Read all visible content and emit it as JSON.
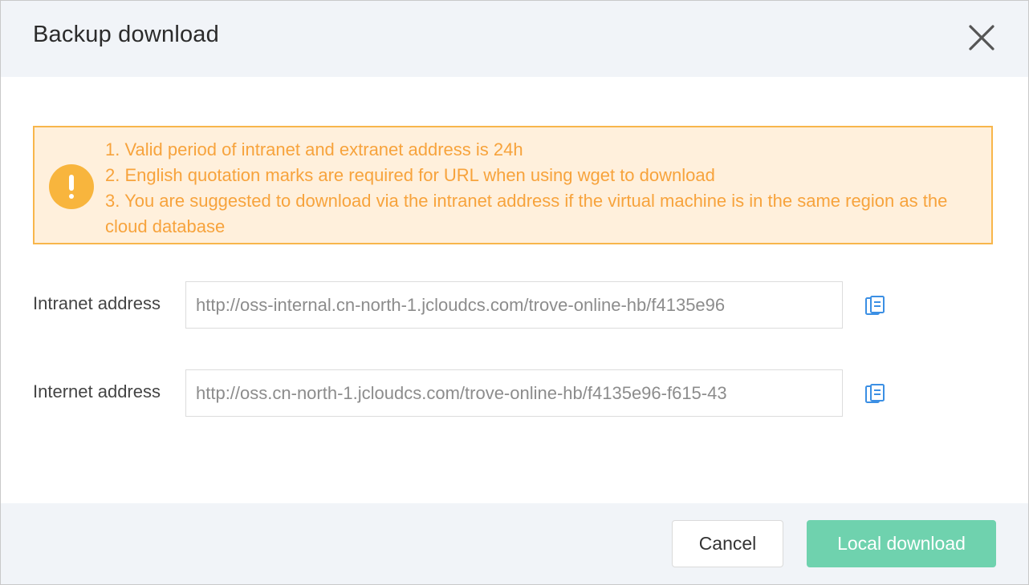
{
  "dialog": {
    "title": "Backup download",
    "close_icon": "close-icon"
  },
  "notice": {
    "icon": "warning-icon",
    "color": "#f7a33c",
    "background": "#fff0dc",
    "lines": [
      "1. Valid period of intranet and extranet address is 24h",
      "2. English quotation marks are required for URL when using wget to download",
      "3. You are suggested to download via the intranet address if the virtual machine is in the same region as the cloud database"
    ]
  },
  "fields": {
    "intranet": {
      "label": "Intranet address",
      "value": "http://oss-internal.cn-north-1.jcloudcs.com/trove-online-hb/f4135e96",
      "copy_icon": "copy-icon"
    },
    "internet": {
      "label": "Internet address",
      "value": "http://oss.cn-north-1.jcloudcs.com/trove-online-hb/f4135e96-f615-43",
      "copy_icon": "copy-icon"
    }
  },
  "footer": {
    "cancel_label": "Cancel",
    "primary_label": "Local download",
    "primary_color": "#6fd2ae"
  }
}
